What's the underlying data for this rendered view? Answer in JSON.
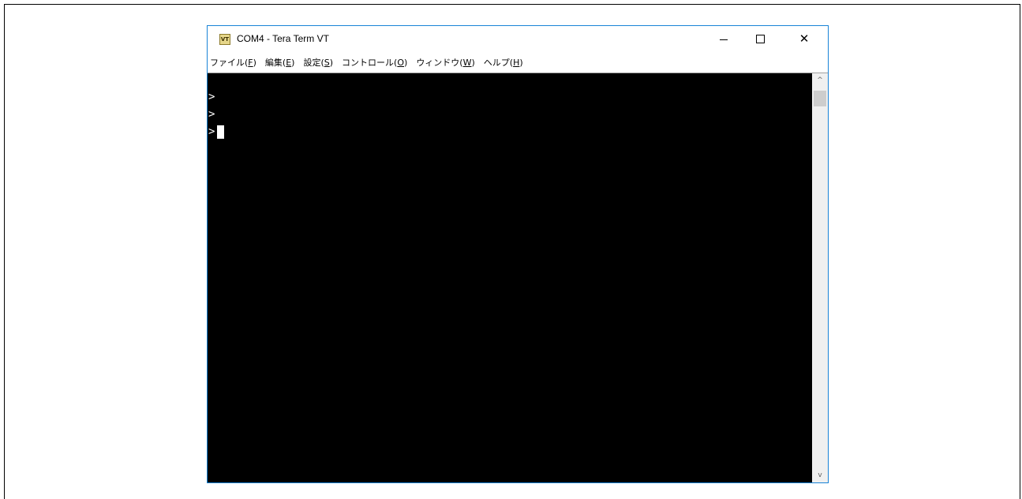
{
  "window": {
    "title": "COM4 - Tera Term VT",
    "icon_label": "VT",
    "accent_border_color": "#1883d7"
  },
  "title_buttons": {
    "minimize_icon": "minimize-icon",
    "maximize_icon": "maximize-icon",
    "close_label": "✕"
  },
  "menu": [
    {
      "label": "ファイル(",
      "key": "F",
      "suffix": ")"
    },
    {
      "label": "編集(",
      "key": "E",
      "suffix": ")"
    },
    {
      "label": "設定(",
      "key": "S",
      "suffix": ")"
    },
    {
      "label": "コントロール(",
      "key": "O",
      "suffix": ")"
    },
    {
      "label": "ウィンドウ(",
      "key": "W",
      "suffix": ")"
    },
    {
      "label": "ヘルプ(",
      "key": "H",
      "suffix": ")"
    }
  ],
  "terminal": {
    "background": "#000000",
    "foreground": "#ffffff",
    "lines": [
      ">",
      ">",
      ">"
    ]
  },
  "scrollbar": {
    "up_arrow": "^",
    "down_arrow": "v"
  }
}
